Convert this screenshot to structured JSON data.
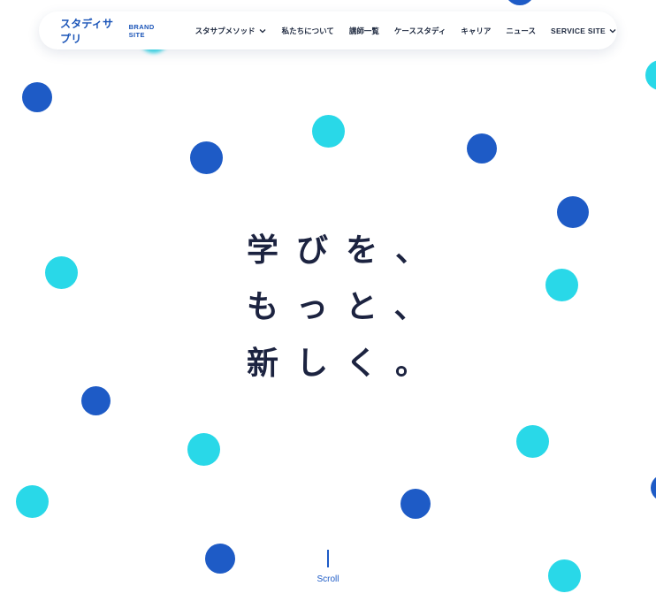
{
  "header": {
    "logo_text": "スタディサプリ",
    "logo_sub": "BRAND SITE",
    "nav": [
      {
        "label": "スタサプメソッド",
        "has_dropdown": true
      },
      {
        "label": "私たちについて",
        "has_dropdown": false
      },
      {
        "label": "講師一覧",
        "has_dropdown": false
      },
      {
        "label": "ケーススタディ",
        "has_dropdown": false
      },
      {
        "label": "キャリア",
        "has_dropdown": false
      },
      {
        "label": "ニュース",
        "has_dropdown": false
      },
      {
        "label": "SERVICE SITE",
        "has_dropdown": true
      }
    ]
  },
  "hero": {
    "lines": [
      "学びを、",
      "もっと、",
      "新しく。"
    ]
  },
  "scroll": {
    "label": "Scroll"
  },
  "colors": {
    "dot_blue": "#1e5bc6",
    "dot_cyan": "#29d8e8",
    "text_dark": "#1c2340",
    "brand": "#1b55b8"
  },
  "icons": {
    "dropdown": "chevron-down-icon"
  }
}
